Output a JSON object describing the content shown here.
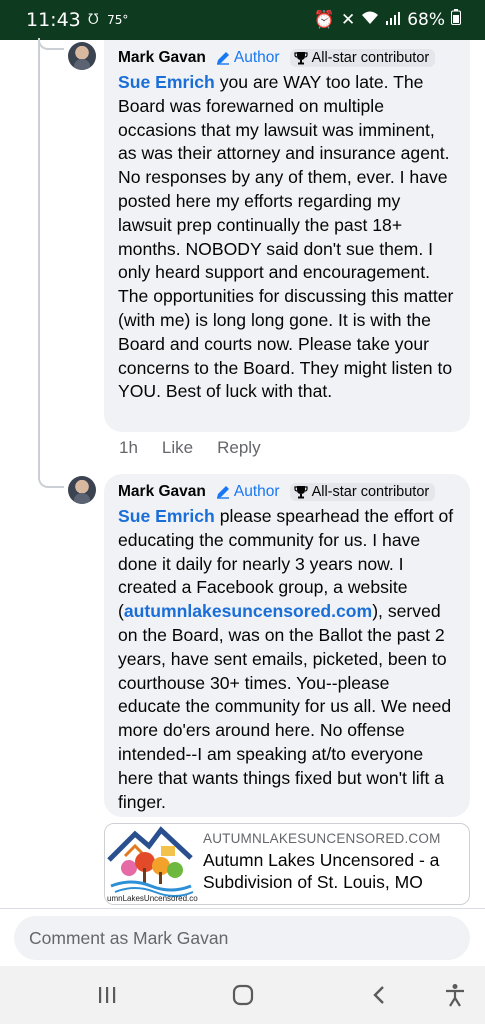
{
  "status_bar": {
    "time": "11:43",
    "temperature": "75°",
    "battery": "68%",
    "icons": [
      "alarm-icon",
      "mute-icon",
      "wifi-icon",
      "signal-icon",
      "battery-icon"
    ]
  },
  "comments": [
    {
      "author": "Mark Gavan",
      "author_tag": "Author",
      "badge": "All-star contributor",
      "mention": "Sue Emrich",
      "text": " you are WAY too late. The Board was forewarned on multiple occasions that my lawsuit was imminent, as was their attorney and insurance agent. No responses by any of them, ever. I have posted here my efforts regarding my lawsuit prep continually the past 18+ months. NOBODY said don't sue them. I only heard support and encouragement. The opportunities for discussing this matter (with me) is long long gone. It is with the Board and courts now. Please take your concerns to the Board. They might listen to YOU. Best of luck with that.",
      "time": "1h",
      "like_label": "Like",
      "reply_label": "Reply"
    },
    {
      "author": "Mark Gavan",
      "author_tag": "Author",
      "badge": "All-star contributor",
      "mention": "Sue Emrich",
      "text_before_link": " please spearhead the effort of educating the community for us. I have done it daily for nearly 3 years now. I created a Facebook group, a website (",
      "link": "autumnlakesuncensored.com",
      "text_after_link": "), served on the Board, was on the Ballot the past 2 years, have sent emails, picketed, been to courthouse 30+ times. You--please educate the community for us all.  We need more do'ers around here. No offense intended--I am speaking at/to everyone here that wants things fixed but won't lift a finger."
    }
  ],
  "link_preview": {
    "domain": "AUTUMNLAKESUNCENSORED.COM",
    "title": "Autumn Lakes Uncensored - a Subdivision of St. Louis, MO",
    "image_caption": "umnLakesUncensored.co"
  },
  "comment_input": {
    "placeholder": "Comment as Mark Gavan"
  },
  "nav_bar": {
    "icons": [
      "recent-apps-icon",
      "home-icon",
      "back-icon",
      "accessibility-icon"
    ]
  },
  "colors": {
    "status_bar_bg": "#0e3b1f",
    "link_blue": "#1a6ed8",
    "bubble_bg": "#f0f2f5"
  }
}
